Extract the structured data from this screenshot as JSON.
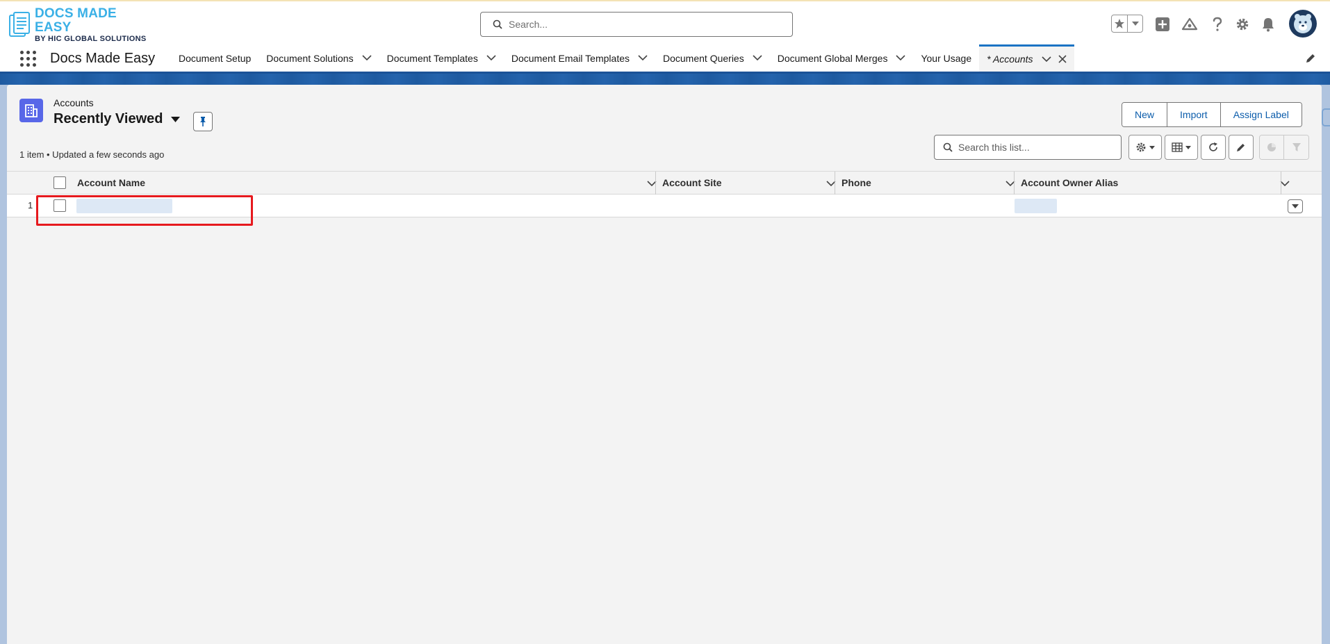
{
  "header": {
    "logo_main": "DOCS MADE EASY",
    "logo_sub": "BY HIC GLOBAL SOLUTIONS",
    "search_placeholder": "Search..."
  },
  "nav": {
    "app_name": "Docs Made Easy",
    "items": [
      {
        "label": "Document Setup",
        "has_menu": false
      },
      {
        "label": "Document Solutions",
        "has_menu": true
      },
      {
        "label": "Document Templates",
        "has_menu": true
      },
      {
        "label": "Document Email Templates",
        "has_menu": true
      },
      {
        "label": "Document Queries",
        "has_menu": true
      },
      {
        "label": "Document Global Merges",
        "has_menu": true
      },
      {
        "label": "Your Usage",
        "has_menu": false
      }
    ],
    "active_tab": "* Accounts"
  },
  "list_view": {
    "object_label": "Accounts",
    "list_name": "Recently Viewed",
    "meta": "1 item • Updated a few seconds ago",
    "actions": [
      "New",
      "Import",
      "Assign Label"
    ],
    "search_placeholder": "Search this list..."
  },
  "table": {
    "columns": [
      "Account Name",
      "Account Site",
      "Phone",
      "Account Owner Alias"
    ],
    "rows": [
      {
        "number": "1"
      }
    ]
  },
  "colors": {
    "brand_blue": "#1b5297",
    "link_blue": "#0b5cab",
    "object_icon": "#5867e8",
    "highlight": "#e6191e"
  }
}
